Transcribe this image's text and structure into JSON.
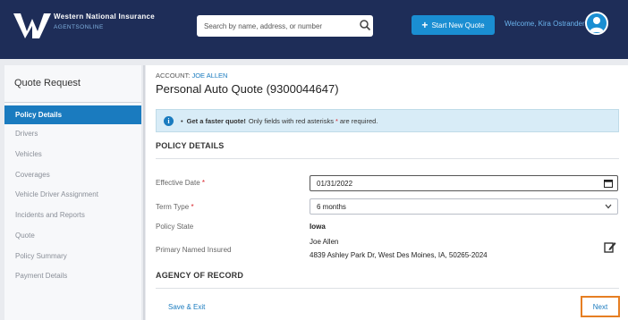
{
  "header": {
    "brand_name": "Western National Insurance",
    "brand_sub": "AGENTSONLINE",
    "search_placeholder": "Search by name, address, or number",
    "start_quote_label": "Start New Quote",
    "welcome_text": "Welcome, Kira Ostrander"
  },
  "sidebar": {
    "title": "Quote Request",
    "items": [
      {
        "label": "Policy Details",
        "active": true
      },
      {
        "label": "Drivers"
      },
      {
        "label": "Vehicles"
      },
      {
        "label": "Coverages"
      },
      {
        "label": "Vehicle Driver Assignment"
      },
      {
        "label": "Incidents and Reports"
      },
      {
        "label": "Quote"
      },
      {
        "label": "Policy Summary"
      },
      {
        "label": "Payment Details"
      }
    ]
  },
  "main": {
    "account_label": "ACCOUNT:",
    "account_name": "JOE ALLEN",
    "title": "Personal Auto Quote (9300044647)",
    "banner": {
      "bullet": "•",
      "strong": "Get a faster quote!",
      "text": "Only fields with red asterisks",
      "star": "*",
      "tail": "are required."
    },
    "policy_details_heading": "POLICY DETAILS",
    "fields": {
      "effective_date_label": "Effective Date",
      "effective_date_value": "01/31/2022",
      "term_type_label": "Term Type",
      "term_type_value": "6 months",
      "policy_state_label": "Policy State",
      "policy_state_value": "Iowa",
      "primary_insured_label": "Primary Named Insured",
      "primary_insured_name": "Joe Allen",
      "primary_insured_address": "4839 Ashley Park Dr, West Des Moines, IA, 50265-2024",
      "required_mark": "*"
    },
    "agency_heading": "AGENCY OF RECORD",
    "save_exit_label": "Save & Exit",
    "next_label": "Next"
  },
  "colors": {
    "header_bg": "#1e2d58",
    "accent": "#1a7bbf",
    "required": "#d8232a",
    "next_highlight": "#e67e22"
  }
}
